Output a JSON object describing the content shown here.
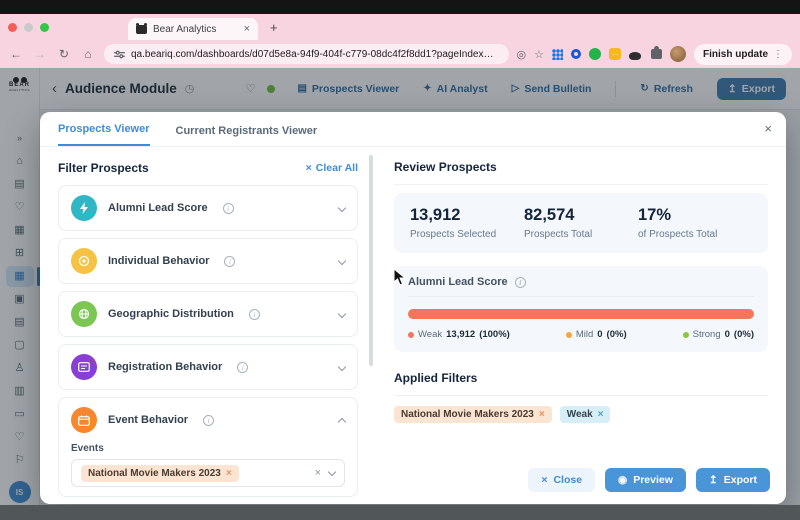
{
  "browser": {
    "tab_title": "Bear Analytics",
    "tab_close_icon": "×",
    "new_tab_icon": "+",
    "back_icon": "←",
    "forward_icon": "→",
    "reload_icon": "↻",
    "home_icon": "⌂",
    "url": "qa.beariq.com/dashboards/d07d5e8a-94f9-404f-c779-08dc4f2f8dd1?pageIndex=1&pageSize=25&sortOrders=%7B...",
    "keyhole_icon": "◎",
    "star_icon": "☆",
    "notes_ext_glyph": "…",
    "update_button_label": "Finish update",
    "menu_dots_icon": "⋮",
    "traffic_colors": {
      "close": "#f35f57",
      "minimize": "#c9c9c9",
      "zoom": "#33c748"
    }
  },
  "app": {
    "logo_text": "BEAR",
    "logo_subtext": "ANALYTICS",
    "header": {
      "back_icon": "‹",
      "title": "Audience Module",
      "history_icon": "◷",
      "heart_icon": "♡",
      "status_dot_color": "#6fbf3f",
      "actions": {
        "prospects_viewer_icon": "▤",
        "prospects_viewer": "Prospects Viewer",
        "ai_analyst_icon": "✦",
        "ai_analyst": "AI Analyst",
        "send_bulletin_icon": "▷",
        "send_bulletin": "Send Bulletin",
        "refresh_icon": "↻",
        "refresh": "Refresh",
        "export_icon": "↥",
        "export": "Export"
      }
    },
    "sidebar": {
      "glyphs": [
        "»",
        "⌂",
        "▤",
        "♡",
        "▦",
        "⊞",
        "▦",
        "▣",
        "▤",
        "▢",
        "♙",
        "▥",
        "▭",
        "♡",
        "⚐"
      ],
      "active_index": 6,
      "avatar_initials": "IS"
    }
  },
  "modal": {
    "close_icon": "×",
    "tabs": [
      {
        "label": "Prospects Viewer"
      },
      {
        "label": "Current Registrants Viewer"
      }
    ],
    "filters": {
      "title": "Filter Prospects",
      "clear_all_icon": "×",
      "clear_all": "Clear All",
      "sections": [
        {
          "label": "Alumni Lead Score",
          "icon": "lightning-icon",
          "color": "#2fb7c6"
        },
        {
          "label": "Individual Behavior",
          "icon": "target-icon",
          "color": "#f6c243"
        },
        {
          "label": "Geographic Distribution",
          "icon": "globe-icon",
          "color": "#7cc754"
        },
        {
          "label": "Registration Behavior",
          "icon": "registration-card-icon",
          "color": "#8a3fd4"
        },
        {
          "label": "Event Behavior",
          "icon": "calendar-icon",
          "color": "#f6862f"
        }
      ],
      "events": {
        "label": "Events",
        "tag": "National Movie Makers 2023",
        "tag_remove_icon": "×",
        "clear_icon": "×"
      }
    },
    "review": {
      "title": "Review Prospects",
      "stats": [
        {
          "value": "13,912",
          "label": "Prospects Selected"
        },
        {
          "value": "82,574",
          "label": "Prospects Total"
        },
        {
          "value": "17%",
          "label": "of Prospects Total"
        }
      ],
      "score": {
        "title": "Alumni Lead Score",
        "bar_color": "#f4765a",
        "bar_pct": 100,
        "legend": [
          {
            "name": "Weak",
            "value": "13,912",
            "pct": "(100%)",
            "color": "#f4765a"
          },
          {
            "name": "Mild",
            "value": "0",
            "pct": "(0%)",
            "color": "#f6a53d"
          },
          {
            "name": "Strong",
            "value": "0",
            "pct": "(0%)",
            "color": "#8cc640"
          }
        ]
      },
      "applied": {
        "title": "Applied Filters",
        "tags": [
          {
            "label": "National Movie Makers 2023",
            "remove_icon": "×"
          },
          {
            "label": "Weak",
            "remove_icon": "×"
          }
        ]
      }
    },
    "footer": {
      "close_icon": "×",
      "close": "Close",
      "preview_icon": "◉",
      "preview": "Preview",
      "export_icon": "↥",
      "export": "Export"
    }
  }
}
